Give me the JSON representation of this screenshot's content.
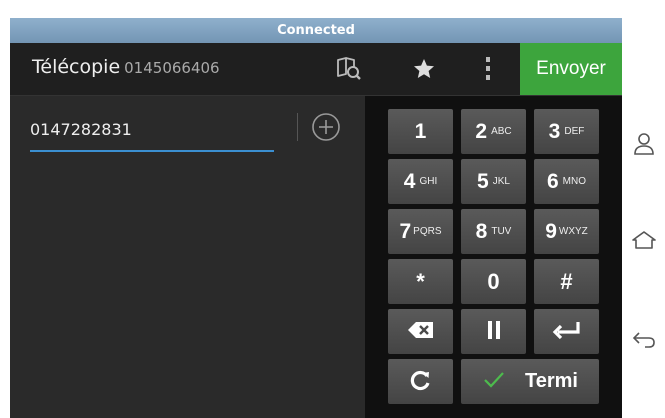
{
  "status": {
    "text": "Connected"
  },
  "header": {
    "title": "Télécopie",
    "number": "0145066406",
    "send_label": "Envoyer"
  },
  "dialer": {
    "entered_number": "0147282831"
  },
  "keypad": {
    "keys": [
      {
        "digit": "1",
        "letters": ""
      },
      {
        "digit": "2",
        "letters": "ABC"
      },
      {
        "digit": "3",
        "letters": "DEF"
      },
      {
        "digit": "4",
        "letters": "GHI"
      },
      {
        "digit": "5",
        "letters": "JKL"
      },
      {
        "digit": "6",
        "letters": "MNO"
      },
      {
        "digit": "7",
        "letters": "PQRS"
      },
      {
        "digit": "8",
        "letters": "TUV"
      },
      {
        "digit": "9",
        "letters": "WXYZ"
      },
      {
        "digit": "*",
        "letters": ""
      },
      {
        "digit": "0",
        "letters": ""
      },
      {
        "digit": "#",
        "letters": ""
      }
    ],
    "end_label": "Termi"
  },
  "icons": {
    "contacts": "contacts-book-icon",
    "favorites": "star-icon",
    "menu": "overflow-menu-icon",
    "add": "add-circle-icon",
    "backspace": "backspace-icon",
    "pause": "pause-icon",
    "enter": "enter-icon",
    "redial": "redial-icon",
    "check": "check-icon",
    "nav_person": "person-icon",
    "nav_home": "home-icon",
    "nav_back": "back-icon"
  },
  "colors": {
    "accent": "#3b8fd1",
    "send": "#3da53d",
    "check": "#3da53d",
    "status_bar": "#7f9fbe"
  }
}
